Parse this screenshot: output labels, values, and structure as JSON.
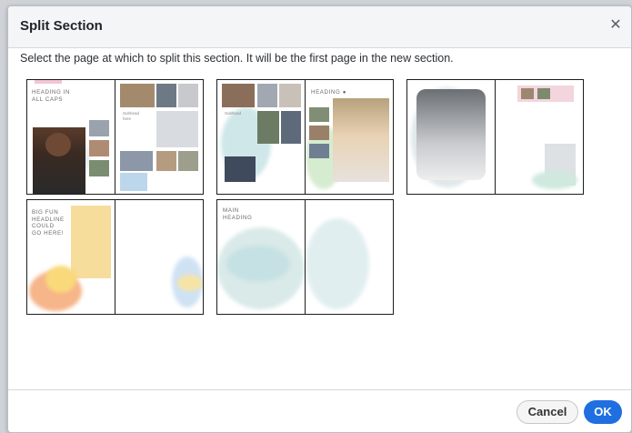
{
  "dialog": {
    "title": "Split Section",
    "instruction": "Select the page at which to split this section. It will be the first page in the new section.",
    "cancel_label": "Cancel",
    "ok_label": "OK",
    "accent_color": "#1f6fe0"
  },
  "spreads": [
    {
      "left_heading": "HEADING in\nALL CAPS",
      "right_subtext": "Subhead\nhere"
    },
    {
      "left_subtext": "Subhead",
      "right_heading": "HEADING  ●"
    },
    {},
    {
      "left_heading": "BIG FUN\nHEADLINE\nCOULD\nGO HERE!"
    },
    {
      "left_heading": "MAIN\nHEADING"
    }
  ]
}
